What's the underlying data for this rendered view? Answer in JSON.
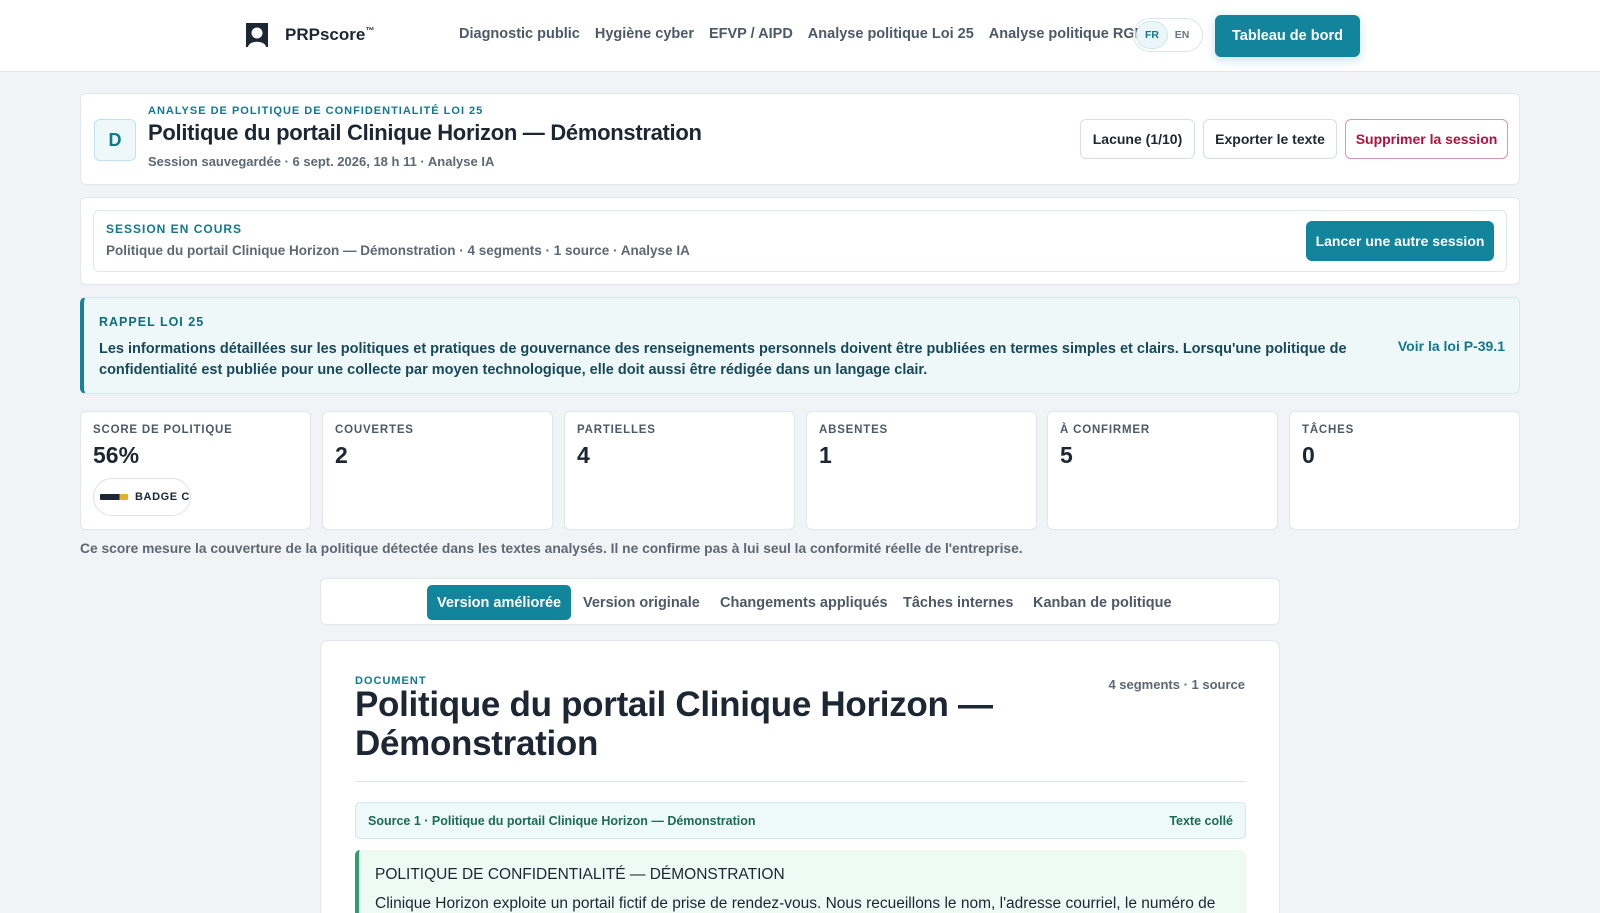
{
  "nav": {
    "brand": "PRPscore",
    "brand_tm": "™",
    "links": [
      "Diagnostic public",
      "Hygiène cyber",
      "EFVP / AIPD",
      "Analyse politique Loi 25",
      "Analyse politique RGPD"
    ],
    "lang": [
      "FR",
      "EN"
    ],
    "lang_active": "FR",
    "dashboard_label": "Tableau de bord"
  },
  "header": {
    "avatar_letter": "D",
    "eyebrow": "ANALYSE DE POLITIQUE DE CONFIDENTIALITÉ LOI 25",
    "title": "Politique du portail Clinique Horizon — Démonstration",
    "meta": "Session sauvegardée · 6 sept. 2026, 18 h 11 · Analyse IA",
    "buttons": {
      "gap": "Lacune (1/10)",
      "export": "Exporter le texte",
      "delete": "Supprimer la session"
    }
  },
  "session": {
    "eyebrow": "SESSION EN COURS",
    "description": "Politique du portail Clinique Horizon — Démonstration · 4 segments · 1 source · Analyse IA",
    "launch_label": "Lancer une autre session"
  },
  "reminder": {
    "eyebrow": "RAPPEL LOI 25",
    "text": "Les informations détaillées sur les politiques et pratiques de gouvernance des renseignements personnels doivent être publiées en termes simples et clairs. Lorsqu'une politique de confidentialité est publiée pour une collecte par moyen technologique, elle doit aussi être rédigée dans un langage clair.",
    "link": "Voir la loi P-39.1"
  },
  "stats": [
    {
      "label": "SCORE DE POLITIQUE",
      "value": "56%",
      "badge": "BADGE C"
    },
    {
      "label": "COUVERTES",
      "value": "2"
    },
    {
      "label": "PARTIELLES",
      "value": "4"
    },
    {
      "label": "ABSENTES",
      "value": "1"
    },
    {
      "label": "À CONFIRMER",
      "value": "5"
    },
    {
      "label": "TÂCHES",
      "value": "0"
    }
  ],
  "score_note": "Ce score mesure la couverture de la politique détectée dans les textes analysés. Il ne confirme pas à lui seul la conformité réelle de l'entreprise.",
  "tabs": [
    "Version améliorée",
    "Version originale",
    "Changements appliqués",
    "Tâches internes",
    "Kanban de politique"
  ],
  "tab_active": "Version améliorée",
  "document": {
    "eyebrow": "DOCUMENT",
    "counts": "4 segments · 1 source",
    "title": "Politique du portail Clinique Horizon — Démonstration",
    "source": {
      "title": "Source 1 · Politique du portail Clinique Horizon — Démonstration",
      "kind": "Texte collé"
    },
    "segment": {
      "heading": "POLITIQUE DE CONFIDENTIALITÉ — DÉMONSTRATION",
      "text": "Clinique Horizon exploite un portail fictif de prise de rendez-vous. Nous recueillons le nom, l'adresse courriel, le numéro de"
    }
  },
  "colors": {
    "accent": "#12849c",
    "danger": "#b0123d",
    "source_green": "#1a6b57",
    "segment_border": "#2d9d6e"
  }
}
